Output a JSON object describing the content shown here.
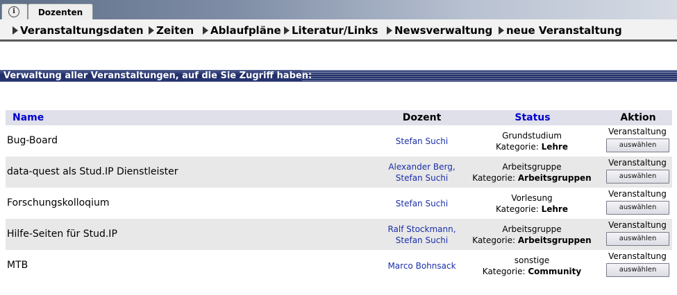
{
  "top_tabs": {
    "info_symbol": "i",
    "main_tab_label": "Dozenten"
  },
  "nav": {
    "items": [
      {
        "label": "Veranstaltungsdaten"
      },
      {
        "label": "Zeiten"
      },
      {
        "label": "Ablaufpläne"
      },
      {
        "label": "Literatur/Links"
      },
      {
        "label": "Newsverwaltung"
      },
      {
        "label": "neue Veranstaltung"
      }
    ]
  },
  "section": {
    "title": "Verwaltung aller Veranstaltungen, auf die Sie Zugriff haben:"
  },
  "table": {
    "headers": {
      "name": "Name",
      "dozent": "Dozent",
      "status": "Status",
      "aktion": "Aktion"
    },
    "category_prefix": "Kategorie:",
    "aktion_label": "Veranstaltung",
    "aktion_button": "auswählen",
    "rows": [
      {
        "name": "Bug-Board",
        "dozent_1": "Stefan Suchi",
        "dozent_2": "",
        "status": "Grundstudium",
        "kategorie": "Lehre"
      },
      {
        "name": "data-quest als Stud.IP Dienstleister",
        "dozent_1": "Alexander Berg,",
        "dozent_2": "Stefan Suchi",
        "status": "Arbeitsgruppe",
        "kategorie": "Arbeitsgruppen"
      },
      {
        "name": "Forschungskolloqium",
        "dozent_1": "Stefan Suchi",
        "dozent_2": "",
        "status": "Vorlesung",
        "kategorie": "Lehre"
      },
      {
        "name": "Hilfe-Seiten für Stud.IP",
        "dozent_1": "Ralf Stockmann,",
        "dozent_2": "Stefan Suchi",
        "status": "Arbeitsgruppe",
        "kategorie": "Arbeitsgruppen"
      },
      {
        "name": "MTB",
        "dozent_1": "Marco Bohnsack",
        "dozent_2": "",
        "status": "sonstige",
        "kategorie": "Community"
      }
    ]
  },
  "colors": {
    "link_blue": "#0000cc",
    "header_bar": "#1f2c66"
  }
}
